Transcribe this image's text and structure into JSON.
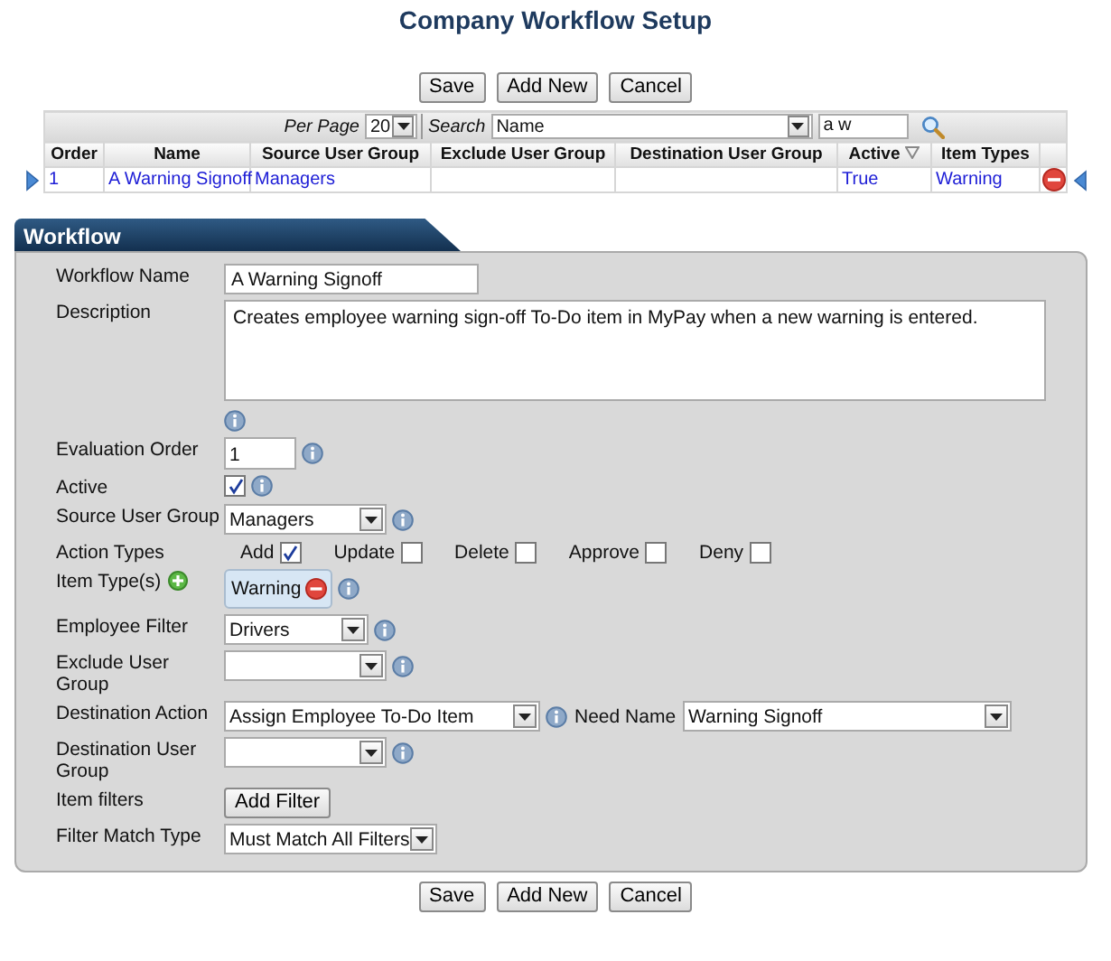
{
  "page_title": "Company Workflow Setup",
  "top_buttons": [
    "Save",
    "Add New",
    "Cancel"
  ],
  "grid": {
    "per_page_label": "Per Page",
    "per_page": "20",
    "search_label": "Search",
    "search_field": "Name",
    "search_value": "a w",
    "columns": [
      {
        "label": "Order",
        "sorted": false
      },
      {
        "label": "Name",
        "sorted": false
      },
      {
        "label": "Source User Group",
        "sorted": false
      },
      {
        "label": "Exclude User Group",
        "sorted": false
      },
      {
        "label": "Destination User Group",
        "sorted": false
      },
      {
        "label": "Active",
        "sorted": true
      },
      {
        "label": "Item Types",
        "sorted": false
      }
    ],
    "rows": [
      {
        "order": "1",
        "name": "A Warning Signoff",
        "source_user_group": "Managers",
        "active": "True",
        "item_types": "Warning",
        "selected": true
      }
    ]
  },
  "workflow": {
    "tab": "Workflow",
    "fields": [
      {
        "kind": "text",
        "label": "Workflow Name",
        "value": "A Warning Signoff",
        "info": false
      },
      {
        "kind": "textarea",
        "label": "Description",
        "value": "Creates employee warning sign-off To-Do item in MyPay when a new warning is entered.",
        "info": true
      },
      {
        "kind": "text",
        "label": "Evaluation Order",
        "value": "1",
        "info": true
      },
      {
        "kind": "checkbox",
        "label": "Active",
        "checked": true,
        "info": true
      },
      {
        "kind": "select",
        "label": "Source User Group",
        "value": "Managers",
        "info": true
      },
      {
        "kind": "actions",
        "label": "Action Types",
        "info": false,
        "options": [
          {
            "label": "Add",
            "checked": true
          },
          {
            "label": "Update",
            "checked": false
          },
          {
            "label": "Delete",
            "checked": false
          },
          {
            "label": "Approve",
            "checked": false
          },
          {
            "label": "Deny",
            "checked": false
          }
        ]
      },
      {
        "kind": "tags",
        "label": "Item Type(s)",
        "tags": [
          "Warning"
        ],
        "info": true
      },
      {
        "kind": "select",
        "label": "Employee Filter",
        "value": "Drivers",
        "info": true
      },
      {
        "kind": "select",
        "label": "Exclude User Group",
        "info": true
      },
      {
        "kind": "select",
        "label": "Destination Action",
        "value": "Assign Employee To-Do Item",
        "info": true,
        "extra_label": "Need Name",
        "extra_value": "Warning Signoff"
      },
      {
        "kind": "select",
        "label": "Destination User Group",
        "info": true
      },
      {
        "kind": "button",
        "label": "Item filters",
        "button": "Add Filter",
        "info": false
      },
      {
        "kind": "select",
        "label": "Filter Match Type",
        "value": "Must Match All Filters",
        "info": false
      }
    ]
  },
  "bottom_buttons": [
    "Save",
    "Add New",
    "Cancel"
  ]
}
